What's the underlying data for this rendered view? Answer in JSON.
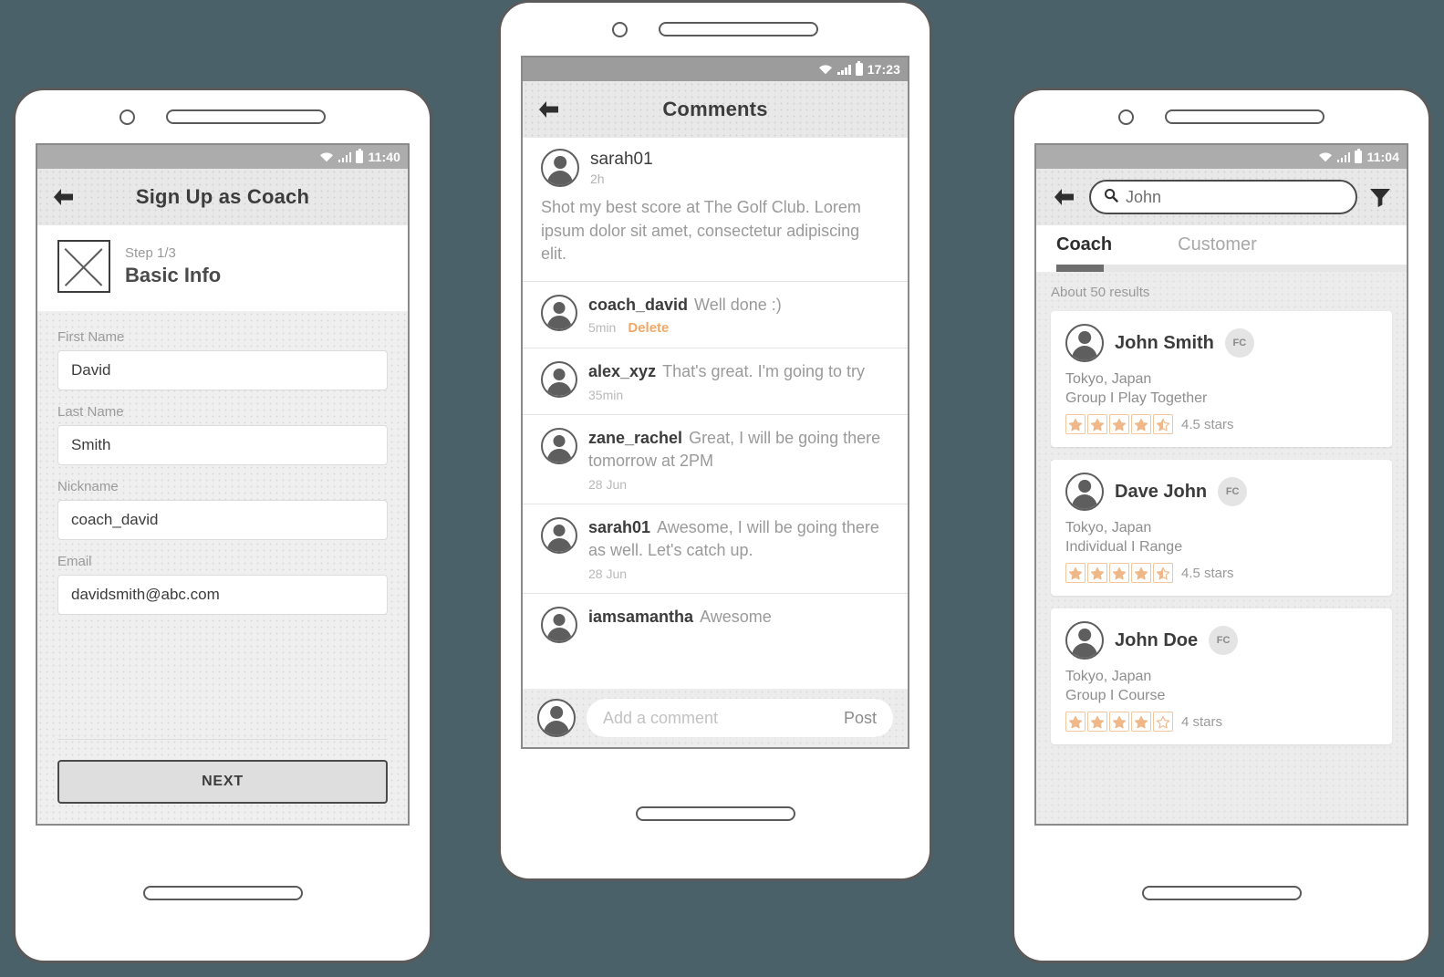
{
  "background_color": "#4a6169",
  "accent_color": "#f0a868",
  "star_color": "#f0b888",
  "phone1": {
    "name": "sign-up-as-coach-screen",
    "statusbar": {
      "time": "11:40",
      "wifi_icon": "wifi-icon",
      "signal_icon": "signal-bars-icon",
      "battery_icon": "battery-icon"
    },
    "appbar": {
      "back_icon": "back-arrow-icon",
      "title": "Sign Up as Coach"
    },
    "step": {
      "image_placeholder_icon": "image-placeholder-icon",
      "label": "Step 1/3",
      "title": "Basic Info"
    },
    "fields": [
      {
        "label": "First Name",
        "value": "David",
        "placeholder": "First Name"
      },
      {
        "label": "Last Name",
        "value": "Smith",
        "placeholder": "Last Name"
      },
      {
        "label": "Nickname",
        "value": "coach_david",
        "placeholder": "Nickname"
      },
      {
        "label": "Email",
        "value": "davidsmith@abc.com",
        "placeholder": "Email"
      }
    ],
    "next_button": "NEXT"
  },
  "phone2": {
    "name": "comments-screen",
    "statusbar": {
      "time": "17:23",
      "wifi_icon": "wifi-icon",
      "signal_icon": "signal-bars-icon",
      "battery_icon": "battery-icon"
    },
    "appbar": {
      "back_icon": "back-arrow-icon",
      "title": "Comments"
    },
    "post": {
      "avatar_icon": "avatar-icon",
      "user": "sarah01",
      "time": "2h",
      "body": "Shot my best score at The Golf Club. Lorem ipsum dolor sit amet, consectetur adipiscing elit."
    },
    "comments": [
      {
        "avatar_icon": "avatar-icon",
        "user": "coach_david",
        "text": "Well done :)",
        "time": "5min",
        "delete": "Delete"
      },
      {
        "avatar_icon": "avatar-icon",
        "user": "alex_xyz",
        "text": "That's great. I'm going to try",
        "time": "35min",
        "delete": ""
      },
      {
        "avatar_icon": "avatar-icon",
        "user": "zane_rachel",
        "text": "Great, I will be going there tomorrow at 2PM",
        "time": "28 Jun",
        "delete": ""
      },
      {
        "avatar_icon": "avatar-icon",
        "user": "sarah01",
        "text": "Awesome, I will be going there as well. Let's catch up.",
        "time": "28 Jun",
        "delete": ""
      },
      {
        "avatar_icon": "avatar-icon",
        "user": "iamsamantha",
        "text": "Awesome",
        "time": "",
        "delete": ""
      }
    ],
    "compose": {
      "avatar_icon": "avatar-icon",
      "placeholder": "Add a comment",
      "value": "",
      "post_label": "Post"
    }
  },
  "phone3": {
    "name": "search-results-screen",
    "statusbar": {
      "time": "11:04",
      "wifi_icon": "wifi-icon",
      "signal_icon": "signal-bars-icon",
      "battery_icon": "battery-icon"
    },
    "appbar": {
      "back_icon": "back-arrow-icon",
      "search_icon": "search-icon",
      "search_value": "John",
      "search_placeholder": "Search",
      "filter_icon": "filter-funnel-icon"
    },
    "tabs": [
      {
        "label": "Coach",
        "active": true
      },
      {
        "label": "Customer",
        "active": false
      }
    ],
    "results_count": "About 50 results",
    "results": [
      {
        "avatar_icon": "avatar-icon",
        "name": "John Smith",
        "badge": "FC",
        "location": "Tokyo, Japan",
        "detail": "Group I Play Together",
        "stars_filled": 4,
        "stars_half": 1,
        "stars_total": 5,
        "rating_text": "4.5 stars"
      },
      {
        "avatar_icon": "avatar-icon",
        "name": "Dave John",
        "badge": "FC",
        "location": "Tokyo, Japan",
        "detail": "Individual I Range",
        "stars_filled": 4,
        "stars_half": 1,
        "stars_total": 5,
        "rating_text": "4.5 stars"
      },
      {
        "avatar_icon": "avatar-icon",
        "name": "John Doe",
        "badge": "FC",
        "location": "Tokyo, Japan",
        "detail": "Group I Course",
        "stars_filled": 4,
        "stars_half": 0,
        "stars_total": 5,
        "rating_text": "4 stars"
      }
    ]
  }
}
